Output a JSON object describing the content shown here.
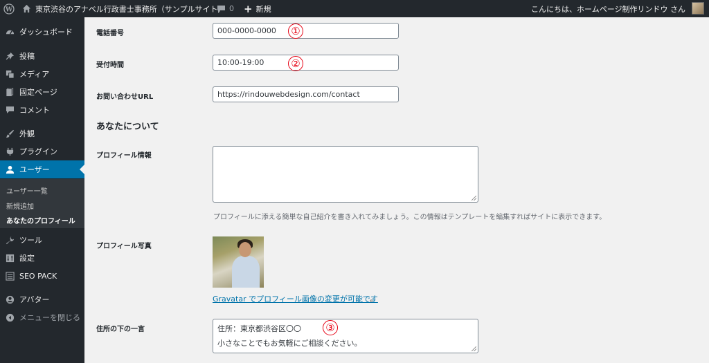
{
  "admin_bar": {
    "site_name": "東京渋谷のアナベル行政書士事務所（サンプルサイト）",
    "comment_count": "0",
    "new_label": "新規",
    "greeting": "こんにちは、ホームページ制作リンドウ さん"
  },
  "sidebar": {
    "items": [
      {
        "label": "ダッシュボード",
        "icon": "dashboard-icon"
      },
      {
        "label": "投稿",
        "icon": "pin-icon"
      },
      {
        "label": "メディア",
        "icon": "media-icon"
      },
      {
        "label": "固定ページ",
        "icon": "page-icon"
      },
      {
        "label": "コメント",
        "icon": "comment-icon"
      },
      {
        "label": "外観",
        "icon": "brush-icon"
      },
      {
        "label": "プラグイン",
        "icon": "plugin-icon"
      },
      {
        "label": "ユーザー",
        "icon": "user-icon"
      },
      {
        "label": "ツール",
        "icon": "wrench-icon"
      },
      {
        "label": "設定",
        "icon": "settings-icon"
      },
      {
        "label": "SEO PACK",
        "icon": "list-icon"
      },
      {
        "label": "アバター",
        "icon": "avatar-icon"
      },
      {
        "label": "メニューを閉じる",
        "icon": "collapse-icon"
      }
    ],
    "submenu": [
      "ユーザー一覧",
      "新規追加",
      "あなたのプロフィール"
    ]
  },
  "form": {
    "phone_label": "電話番号",
    "phone_value": "000-0000-0000",
    "hours_label": "受付時間",
    "hours_value": "10:00-19:00",
    "contact_label": "お問い合わせURL",
    "contact_value": "https://rindouwebdesign.com/contact",
    "about_title": "あなたについて",
    "bio_label": "プロフィール情報",
    "bio_value": "",
    "bio_desc": "プロフィールに添える簡単な自己紹介を書き入れてみましょう。この情報はテンプレートを編集すればサイトに表示できます。",
    "photo_label": "プロフィール写真",
    "gravatar_link": "Gravatar でプロフィール画像の変更が可能です",
    "gravatar_period": "。",
    "address_label": "住所の下の一言",
    "address_line1": "住所：東京都渋谷区〇〇",
    "address_line2": "小さなことでもお気軽にご相談ください。"
  },
  "annotations": [
    "①",
    "②",
    "③"
  ],
  "colors": {
    "admin_bar": "#23282d",
    "accent": "#0073aa",
    "annotation": "#e60012"
  }
}
